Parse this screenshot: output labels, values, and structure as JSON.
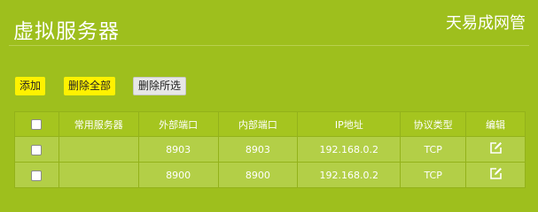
{
  "header": {
    "title": "虚拟服务器",
    "brand": "天易成网管"
  },
  "toolbar": {
    "add_label": "添加",
    "delete_all_label": "删除全部",
    "delete_selected_label": "删除所选"
  },
  "table": {
    "columns": [
      "常用服务器",
      "外部端口",
      "内部端口",
      "IP地址",
      "协议类型",
      "编辑"
    ],
    "rows": [
      {
        "common_server": "",
        "external_port": "8903",
        "internal_port": "8903",
        "ip": "192.168.0.2",
        "protocol": "TCP"
      },
      {
        "common_server": "",
        "external_port": "8900",
        "internal_port": "8900",
        "ip": "192.168.0.2",
        "protocol": "TCP"
      }
    ]
  },
  "colors": {
    "background": "#9ebf1d",
    "header_row": "#a5c51f",
    "body_row": "#b3cf47",
    "accent_button": "#fff200"
  },
  "icons": {
    "edit": "edit-icon",
    "checkbox": "checkbox"
  }
}
